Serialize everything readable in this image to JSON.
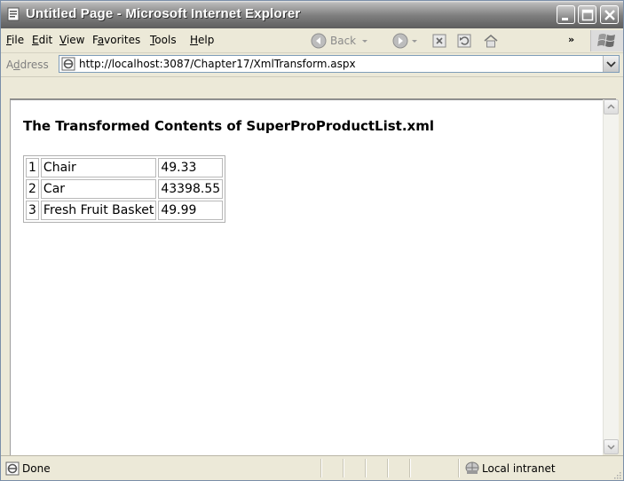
{
  "window": {
    "title": "Untitled Page - Microsoft Internet Explorer"
  },
  "menu": {
    "items": [
      {
        "label": "File",
        "accel": "F",
        "rest": "ile"
      },
      {
        "label": "Edit",
        "accel": "E",
        "rest": "dit"
      },
      {
        "label": "View",
        "accel": "V",
        "rest": "iew"
      },
      {
        "label": "Favorites",
        "pre": "F",
        "accel": "a",
        "rest": "vorites"
      },
      {
        "label": "Tools",
        "accel": "T",
        "rest": "ools"
      },
      {
        "label": "Help",
        "accel": "H",
        "rest": "elp"
      }
    ]
  },
  "toolbar": {
    "back_label": "Back",
    "more": "»"
  },
  "address": {
    "label_pre": "A",
    "label_accel": "d",
    "label_rest": "dress",
    "url": "http://localhost:3087/Chapter17/XmlTransform.aspx"
  },
  "page": {
    "heading": "The Transformed Contents of SuperProProductList.xml",
    "rows": [
      {
        "id": "1",
        "name": "Chair",
        "price": "49.33"
      },
      {
        "id": "2",
        "name": "Car",
        "price": "43398.55"
      },
      {
        "id": "3",
        "name": "Fresh Fruit Basket",
        "price": "49.99"
      }
    ]
  },
  "status": {
    "text": "Done",
    "zone": "Local intranet"
  }
}
